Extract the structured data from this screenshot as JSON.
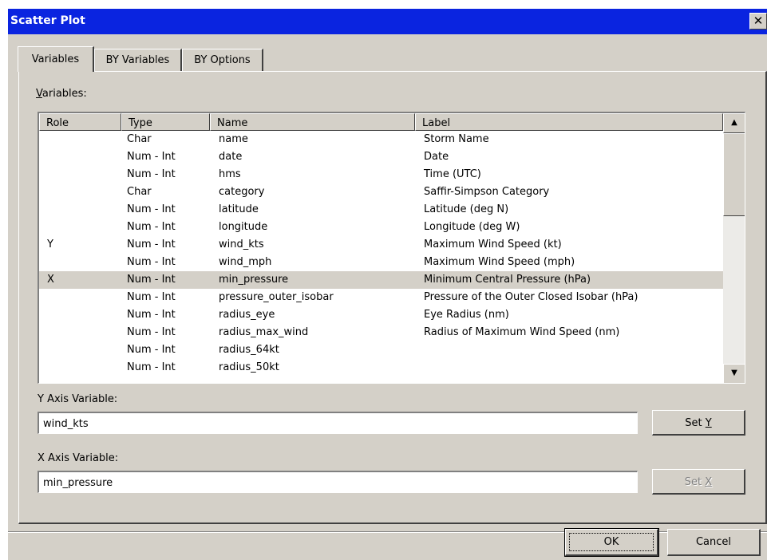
{
  "window": {
    "title": "Scatter Plot",
    "close_symbol": "✕"
  },
  "tabs": [
    {
      "label": "Variables",
      "active": true
    },
    {
      "label": "BY Variables",
      "active": false
    },
    {
      "label": "BY Options",
      "active": false
    }
  ],
  "variables": {
    "label": "Variables:",
    "label_mnemonic": "V",
    "columns": [
      "Role",
      "Type",
      "Name",
      "Label"
    ],
    "rows": [
      {
        "role": "",
        "type": "Char",
        "name": "name",
        "label": "Storm Name"
      },
      {
        "role": "",
        "type": "Num - Int",
        "name": "date",
        "label": "Date"
      },
      {
        "role": "",
        "type": "Num - Int",
        "name": "hms",
        "label": "Time (UTC)"
      },
      {
        "role": "",
        "type": "Char",
        "name": "category",
        "label": "Saffir-Simpson Category"
      },
      {
        "role": "",
        "type": "Num - Int",
        "name": "latitude",
        "label": "Latitude (deg N)"
      },
      {
        "role": "",
        "type": "Num - Int",
        "name": "longitude",
        "label": "Longitude (deg W)"
      },
      {
        "role": "Y",
        "type": "Num - Int",
        "name": "wind_kts",
        "label": "Maximum Wind Speed (kt)"
      },
      {
        "role": "",
        "type": "Num - Int",
        "name": "wind_mph",
        "label": "Maximum Wind Speed (mph)"
      },
      {
        "role": "X",
        "type": "Num - Int",
        "name": "min_pressure",
        "label": "Minimum Central Pressure (hPa)",
        "selected": true
      },
      {
        "role": "",
        "type": "Num - Int",
        "name": "pressure_outer_isobar",
        "label": "Pressure of the Outer Closed Isobar (hPa)"
      },
      {
        "role": "",
        "type": "Num - Int",
        "name": "radius_eye",
        "label": "Eye Radius (nm)"
      },
      {
        "role": "",
        "type": "Num - Int",
        "name": "radius_max_wind",
        "label": "Radius of Maximum Wind Speed (nm)"
      },
      {
        "role": "",
        "type": "Num - Int",
        "name": "radius_64kt",
        "label": ""
      },
      {
        "role": "",
        "type": "Num - Int",
        "name": "radius_50kt",
        "label": ""
      }
    ],
    "scroll_up_icon": "▲",
    "scroll_down_icon": "▼"
  },
  "y_axis": {
    "label": "Y Axis Variable:",
    "value": "wind_kts",
    "button_label": "Set Y",
    "button_enabled": true
  },
  "x_axis": {
    "label": "X Axis Variable:",
    "value": "min_pressure",
    "button_label": "Set X",
    "button_enabled": false
  },
  "footer": {
    "ok_label": "OK",
    "cancel_label": "Cancel"
  }
}
